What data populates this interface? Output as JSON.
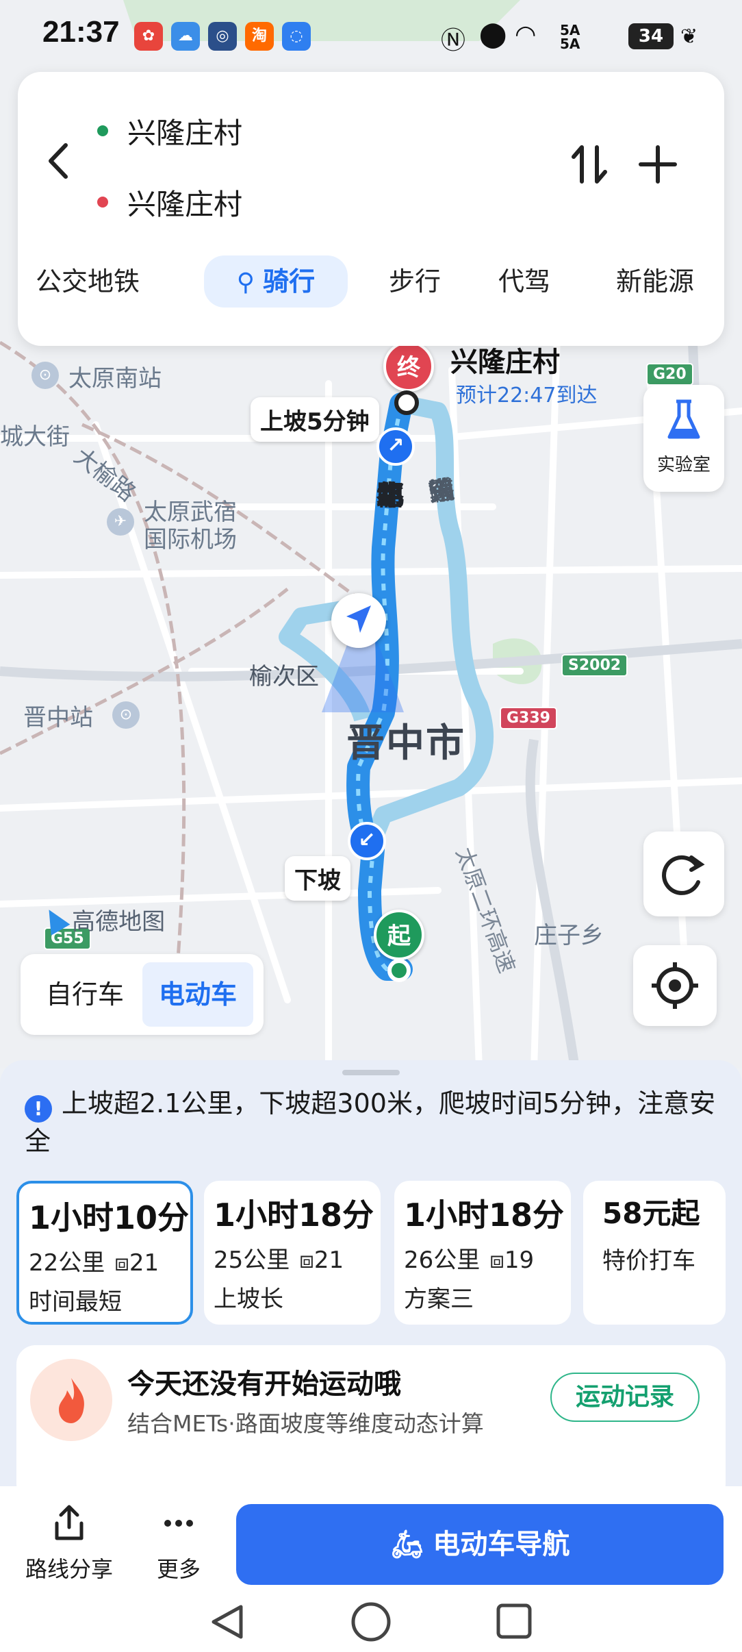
{
  "status_bar": {
    "time": "21:37",
    "battery": "34",
    "network": "5A"
  },
  "route": {
    "start": "兴隆庄村",
    "end": "兴隆庄村",
    "modes": [
      "公交地铁",
      "骑行",
      "步行",
      "代驾",
      "新能源"
    ],
    "active_mode": "骑行"
  },
  "map": {
    "labels": {
      "taiyuan_south": "太原南站",
      "airport_l1": "太原武宿",
      "airport_l2": "国际机场",
      "yuci": "榆次区",
      "jinzhong_station": "晋中站",
      "jinzhong_city": "晋中市",
      "zhuangzi": "庄子乡",
      "dajie": "城大街",
      "dayu": "大榆路",
      "gaode": "高德地图"
    },
    "roads": {
      "zhongdu": [
        "中",
        "都",
        "北",
        "路"
      ],
      "jindong": [
        "锦",
        "东",
        "大",
        "道",
        "辅",
        "路"
      ],
      "ring": "太原二环高速"
    },
    "shields": {
      "g20": "G20",
      "s2002": "S2002",
      "g339": "G339",
      "g55": "G55"
    },
    "end_pin": "终",
    "start_pin": "起",
    "end_name": "兴隆庄村",
    "eta": "预计22:47到达",
    "uphill_callout": "上坡5分钟",
    "downhill_callout": "下坡",
    "lab_label": "实验室"
  },
  "vehicle_toggle": {
    "options": [
      "自行车",
      "电动车"
    ],
    "active": "电动车"
  },
  "sheet": {
    "notice": "上坡超2.1公里，下坡超300米，爬坡时间5分钟，注意安全",
    "options": [
      {
        "time": "1小时10分",
        "dist": "22公里",
        "lights": "21",
        "tag": "时间最短"
      },
      {
        "time": "1小时18分",
        "dist": "25公里",
        "lights": "21",
        "tag": "上坡长"
      },
      {
        "time": "1小时18分",
        "dist": "26公里",
        "lights": "19",
        "tag": "方案三"
      },
      {
        "time": "58元起",
        "tag": "特价打车"
      }
    ],
    "exercise": {
      "title": "今天还没有开始运动哦",
      "subtitle": "结合METs·路面坡度等维度动态计算",
      "button": "运动记录"
    },
    "actions": {
      "share": "路线分享",
      "more": "更多",
      "navigate": "电动车导航"
    }
  },
  "colors": {
    "accent": "#2f6ff2",
    "route": "#2c8fe8",
    "alt_route": "#9fd2ec",
    "start": "#1f9a5c",
    "end": "#e14552"
  }
}
